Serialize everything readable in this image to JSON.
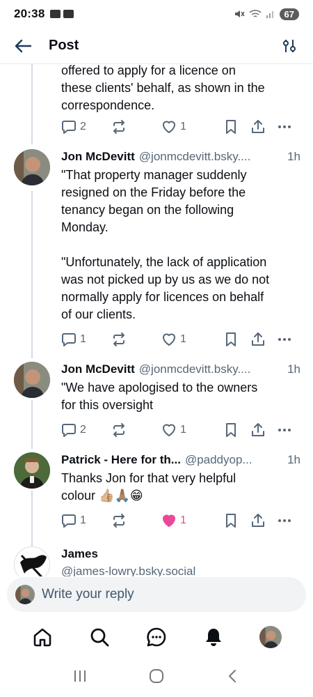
{
  "status": {
    "time": "20:38",
    "battery": "67"
  },
  "header": {
    "title": "Post"
  },
  "colors": {
    "accent": "#1083fe",
    "text": "#0b0f14",
    "muted": "#566778",
    "like": "#ec4899",
    "thread_line": "#d4dbe2"
  },
  "partial_post": {
    "text": "offered to apply for a licence on\nthese clients' behalf, as shown in the\ncorrespondence.",
    "replies": "2",
    "likes": "1"
  },
  "posts": [
    {
      "name": "Jon McDevitt",
      "handle": "@jonmcdevitt.bsky....",
      "age": "1h",
      "text": "\"That property manager suddenly\nresigned on the Friday before the\ntenancy began on the following\nMonday.\n\n\"Unfortunately, the lack of application\nwas not picked up by us as we do not\nnormally apply for licences on behalf\nof our clients.",
      "replies": "1",
      "likes": "1",
      "liked": false
    },
    {
      "name": "Jon McDevitt",
      "handle": "@jonmcdevitt.bsky....",
      "age": "1h",
      "text": "\"We have apologised to the owners\nfor this oversight",
      "replies": "2",
      "likes": "1",
      "liked": false
    },
    {
      "name": "Patrick - Here for th...",
      "handle": "@paddyop...",
      "age": "1h",
      "text": "Thanks Jon for that very helpful\ncolour 👍🏼🙏🏽😁",
      "replies": "1",
      "likes": "1",
      "liked": true
    },
    {
      "name": "James",
      "handle": "@james-lowry.bsky.social",
      "age": "",
      "text": ""
    }
  ],
  "reply_bar": {
    "placeholder": "Write your reply"
  },
  "icons": {
    "back": "arrow-left-icon",
    "filter": "sliders-icon",
    "reply": "speech-bubble-icon",
    "repost": "repost-icon",
    "like": "heart-icon",
    "bookmark": "bookmark-icon",
    "share": "share-icon",
    "more": "more-dots-icon",
    "home": "home-icon",
    "search": "search-icon",
    "chat": "chat-icon",
    "notifications": "bell-icon"
  }
}
